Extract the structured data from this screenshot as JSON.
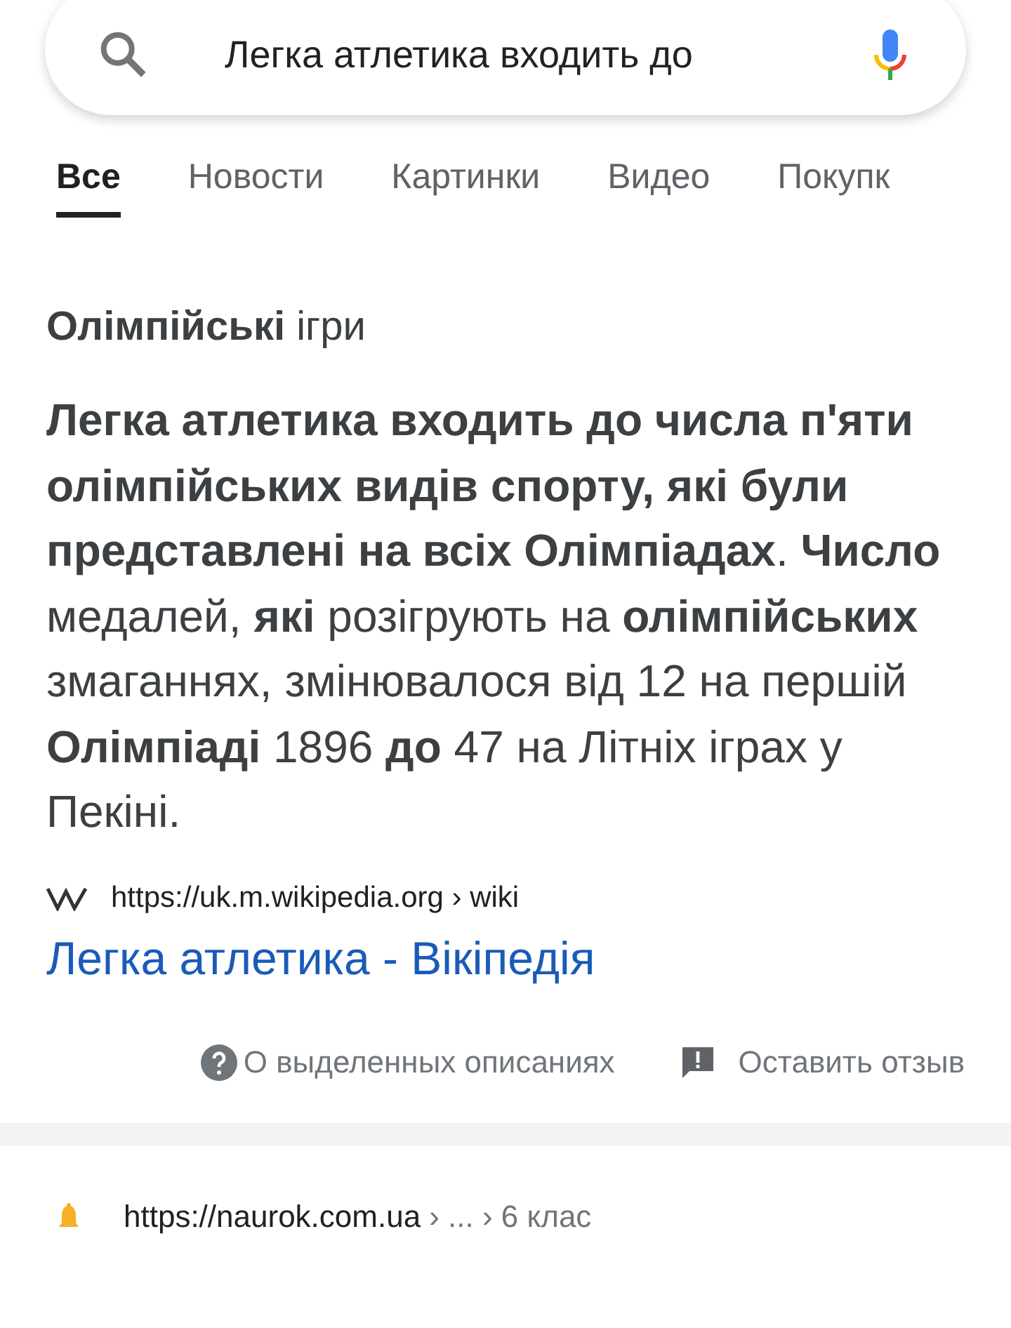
{
  "search": {
    "value": "Легка атлетика входить до"
  },
  "tabs": [
    {
      "label": "Все",
      "selected": true
    },
    {
      "label": "Новости",
      "selected": false
    },
    {
      "label": "Картинки",
      "selected": false
    },
    {
      "label": "Видео",
      "selected": false
    },
    {
      "label": "Покупк",
      "selected": false
    }
  ],
  "featured_snippet": {
    "heading": "**Олімпійські** ігри",
    "text": "**Легка атлетика входить до числа п'яти олімпійських видів спорту, які були представлені на всіх Олімпіадах**. **Число** медалей, **які** розігрують на **олімпійських** змаганнях, змінювалося від 12 на першій **Олімпіаді** 1896 **до** 47 на Літніх іграх у Пекіні.",
    "url": "https://uk.m.wikipedia.org › wiki",
    "title": "Легка атлетика - Вікіпедія",
    "about_link": "О выделенных описаниях",
    "feedback_link": "Оставить отзыв"
  },
  "next_result": {
    "url": "https://naurok.com.ua",
    "breadcrumb": "› ... › 6 клас"
  }
}
